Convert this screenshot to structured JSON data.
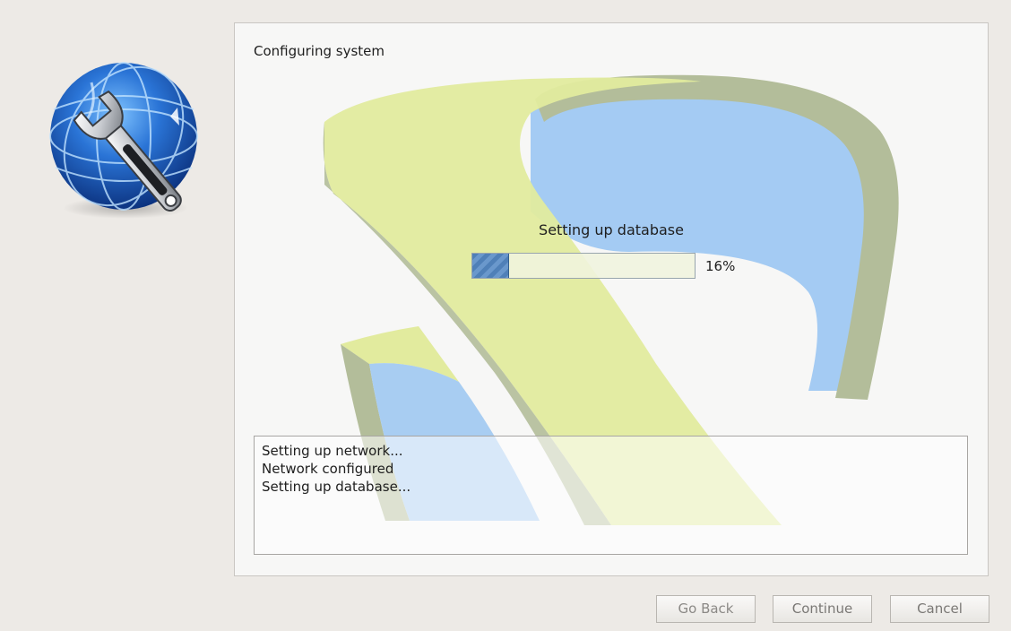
{
  "panel": {
    "title": "Configuring system"
  },
  "progress": {
    "label": "Setting up database",
    "value": 0.16,
    "percent_text": "16%"
  },
  "log": {
    "lines": [
      "Setting up network...",
      "Network configured",
      "Setting up database..."
    ]
  },
  "buttons": {
    "back": "Go Back",
    "continue": "Continue",
    "cancel": "Cancel"
  },
  "colors": {
    "accent": "#4f80b8",
    "art_yellow": "#e2eb9e",
    "art_blue": "#9fc8f2",
    "art_green_shadow": "#b3bd9a"
  },
  "icons": {
    "logo": "globe-wrench-icon"
  }
}
